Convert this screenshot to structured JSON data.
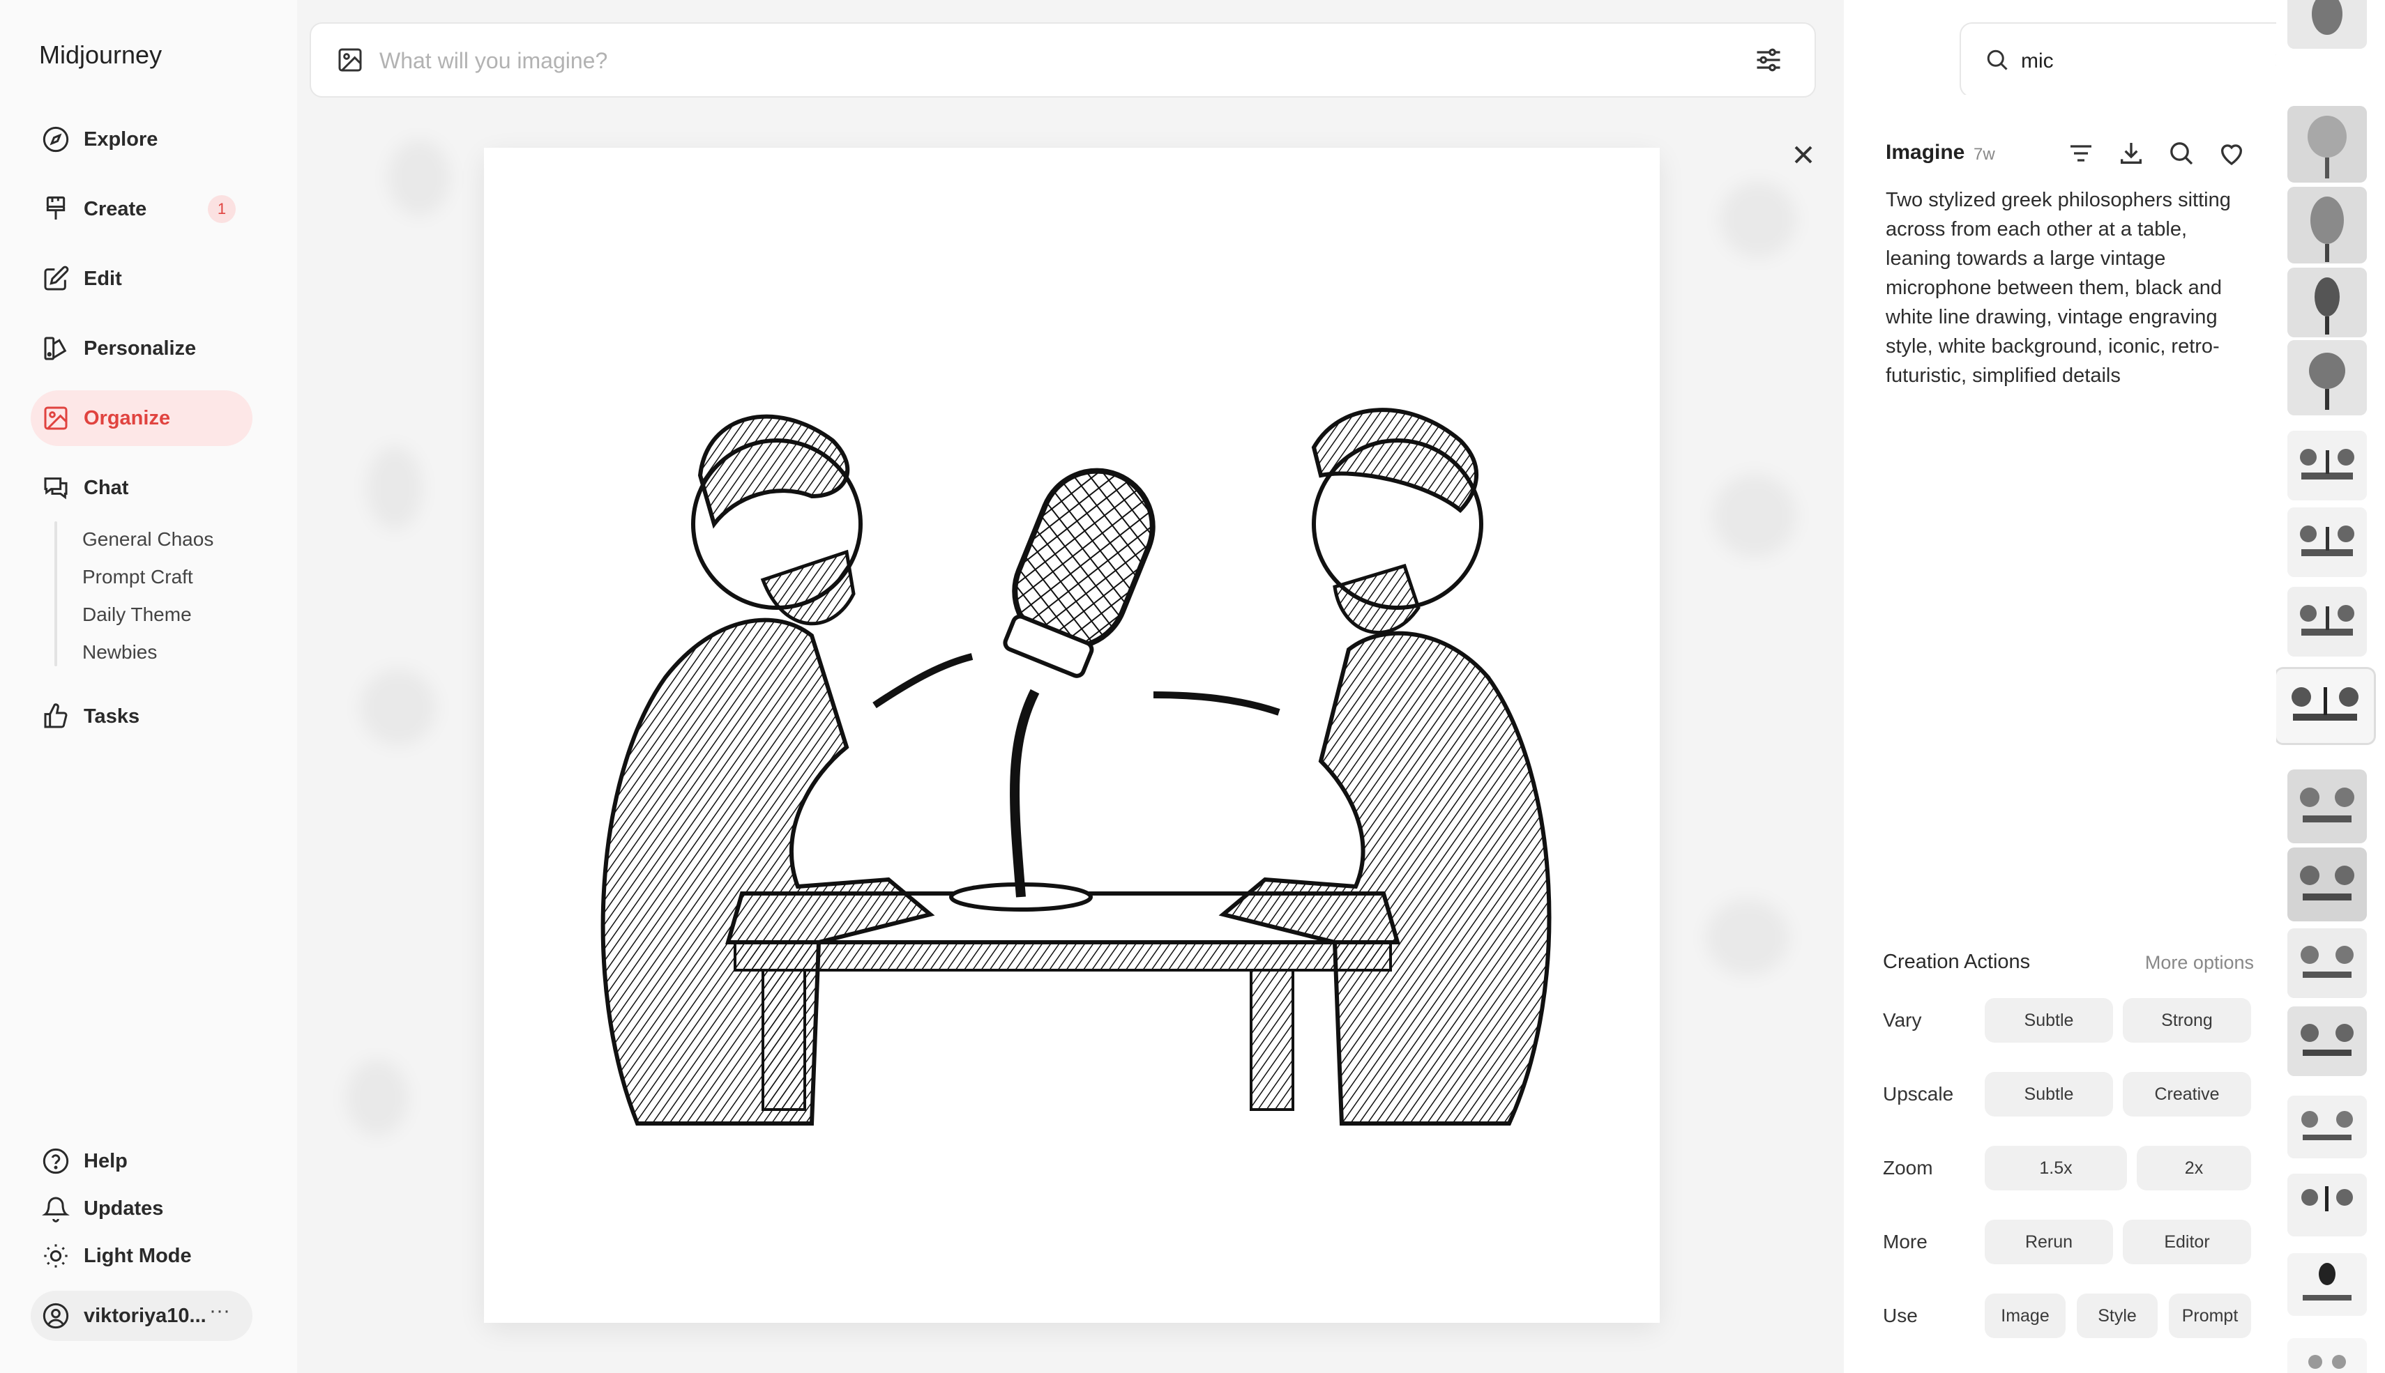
{
  "app": {
    "brand": "Midjourney"
  },
  "sidebar": {
    "items": [
      {
        "label": "Explore",
        "icon": "compass-icon"
      },
      {
        "label": "Create",
        "icon": "paintbrush-icon",
        "badge": "1"
      },
      {
        "label": "Edit",
        "icon": "edit-icon"
      },
      {
        "label": "Personalize",
        "icon": "palette-icon"
      },
      {
        "label": "Organize",
        "icon": "image-icon",
        "active": true
      },
      {
        "label": "Chat",
        "icon": "chat-icon"
      },
      {
        "label": "Tasks",
        "icon": "thumbs-up-icon"
      }
    ],
    "chat_rooms": [
      "General Chaos",
      "Prompt Craft",
      "Daily Theme",
      "Newbies"
    ],
    "bottom": [
      {
        "label": "Help",
        "icon": "help-icon"
      },
      {
        "label": "Updates",
        "icon": "bell-icon"
      },
      {
        "label": "Light Mode",
        "icon": "sun-icon"
      }
    ],
    "user": {
      "name": "viktoriya10...",
      "more": "···"
    }
  },
  "prompt_bar": {
    "placeholder": "What will you imagine?"
  },
  "search": {
    "value": "mic"
  },
  "detail": {
    "title": "Imagine",
    "age": "7w",
    "prompt": "Two stylized greek philosophers sitting across from each other at a table, leaning towards a large vintage microphone between them, black and white line drawing, vintage engraving style, white background, iconic, retro-futuristic, simplified details",
    "creation_actions": {
      "title": "Creation Actions",
      "more": "More options",
      "rows": [
        {
          "label": "Vary",
          "buttons": [
            "Subtle",
            "Strong"
          ]
        },
        {
          "label": "Upscale",
          "buttons": [
            "Subtle",
            "Creative"
          ]
        },
        {
          "label": "Zoom",
          "buttons": [
            "1.5x",
            "2x"
          ]
        },
        {
          "label": "More",
          "buttons": [
            "Rerun",
            "Editor"
          ]
        },
        {
          "label": "Use",
          "buttons": [
            "Image",
            "Style",
            "Prompt"
          ]
        }
      ]
    }
  },
  "colors": {
    "accent": "#e0433f",
    "active_bg": "#fde7e7"
  }
}
